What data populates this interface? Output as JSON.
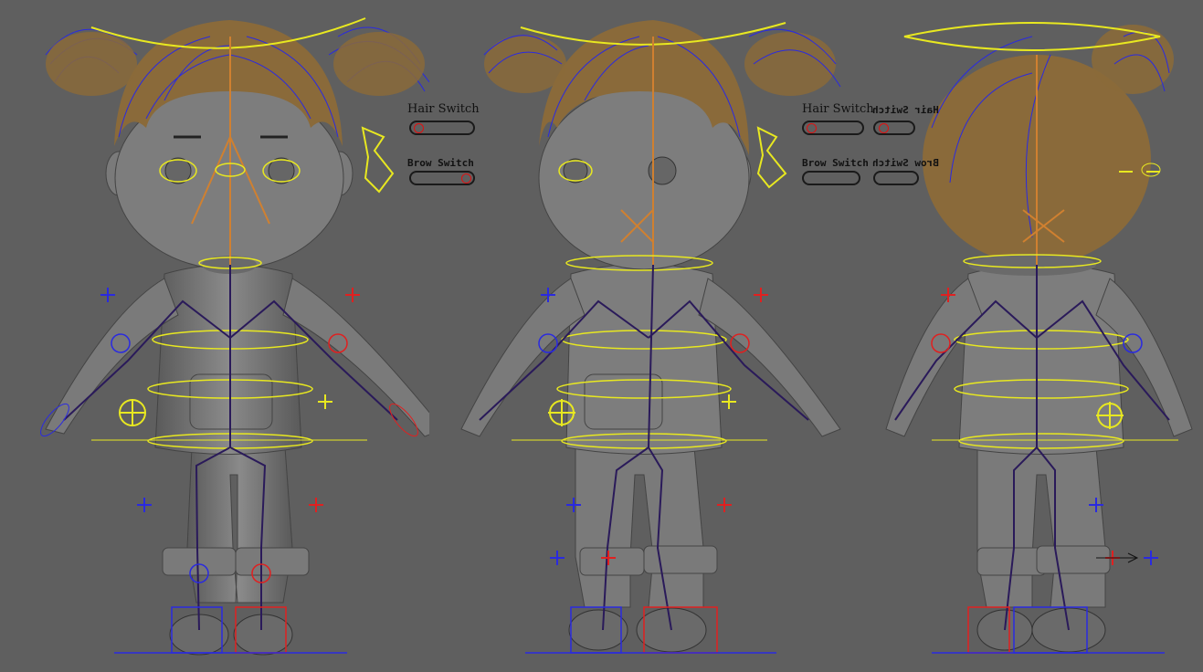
{
  "viewport": {
    "background": "#5f5f5f",
    "views": [
      "front",
      "three-quarter",
      "back"
    ]
  },
  "switches": {
    "hair_label": "Hair Switch",
    "brow_label": "Brow Switch",
    "hair_label_mirrored": "Hair Switch",
    "brow_label_mirrored": "Brow Switch"
  },
  "colors": {
    "hair": "#8a6a3a",
    "control_left": "#2a2ae0",
    "control_right": "#e02020",
    "control_center": "#e8e820",
    "joint": "#2a1a5a",
    "aim": "#d08030",
    "body": "#7a7a7a"
  },
  "icons": [
    "plus-icon",
    "circle-control-icon",
    "arrow-icon"
  ]
}
